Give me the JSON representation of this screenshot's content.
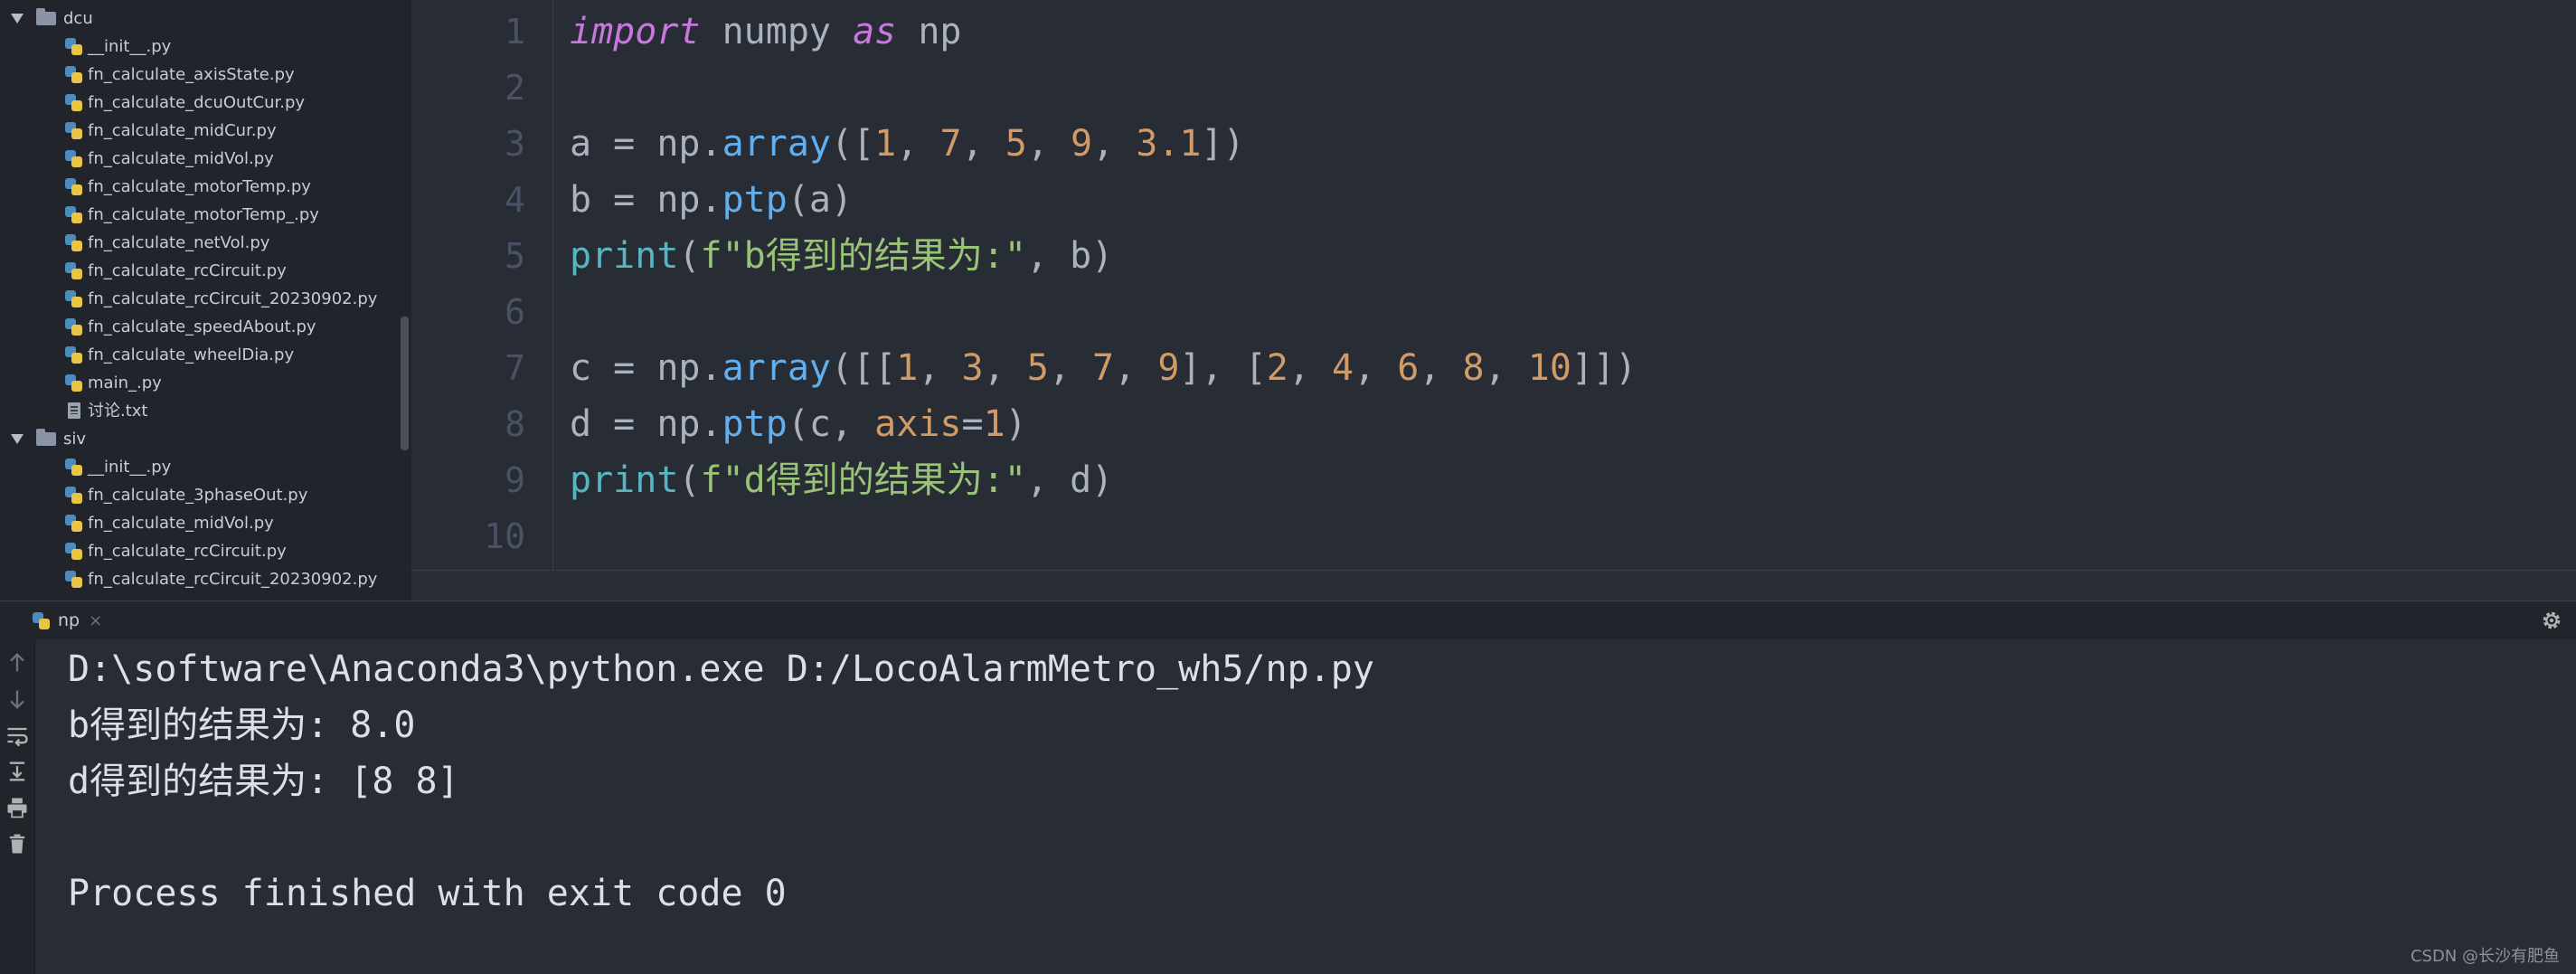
{
  "project_tree": {
    "folders": [
      {
        "name": "dcu",
        "files": [
          "__init__.py",
          "fn_calculate_axisState.py",
          "fn_calculate_dcuOutCur.py",
          "fn_calculate_midCur.py",
          "fn_calculate_midVol.py",
          "fn_calculate_motorTemp.py",
          "fn_calculate_motorTemp_.py",
          "fn_calculate_netVol.py",
          "fn_calculate_rcCircuit.py",
          "fn_calculate_rcCircuit_20230902.py",
          "fn_calculate_speedAbout.py",
          "fn_calculate_wheelDia.py",
          "main_.py",
          "讨论.txt"
        ]
      },
      {
        "name": "siv",
        "files": [
          "__init__.py",
          "fn_calculate_3phaseOut.py",
          "fn_calculate_midVol.py",
          "fn_calculate_rcCircuit.py",
          "fn_calculate_rcCircuit_20230902.py"
        ]
      }
    ]
  },
  "editor": {
    "line_numbers": [
      "1",
      "2",
      "3",
      "4",
      "5",
      "6",
      "7",
      "8",
      "9",
      "10"
    ],
    "code": {
      "l1": {
        "kw_import": "import",
        "t1": " numpy ",
        "kw_as": "as",
        "t2": " np"
      },
      "l3": {
        "t1": "a = np.",
        "fn": "array",
        "t2": "([",
        "n1": "1",
        "c1": ", ",
        "n2": "7",
        "c2": ", ",
        "n3": "5",
        "c3": ", ",
        "n4": "9",
        "c4": ", ",
        "n5": "3.1",
        "t3": "])"
      },
      "l4": {
        "t1": "b = np.",
        "fn": "ptp",
        "t2": "(a)"
      },
      "l5": {
        "bi": "print",
        "t1": "(",
        "str": "f\"b得到的结果为:\"",
        "t2": ", b)"
      },
      "l7": {
        "t1": "c = np.",
        "fn": "array",
        "t2": "([[",
        "n1": "1",
        "c1": ", ",
        "n2": "3",
        "c2": ", ",
        "n3": "5",
        "c3": ", ",
        "n4": "7",
        "c4": ", ",
        "n5": "9",
        "t3": "], [",
        "n6": "2",
        "c5": ", ",
        "n7": "4",
        "c6": ", ",
        "n8": "6",
        "c7": ", ",
        "n9": "8",
        "c8": ", ",
        "n10": "10",
        "t4": "]])"
      },
      "l8": {
        "t1": "d = np.",
        "fn": "ptp",
        "t2": "(c, ",
        "prm": "axis",
        "t3": "=",
        "n1": "1",
        "t4": ")"
      },
      "l9": {
        "bi": "print",
        "t1": "(",
        "str": "f\"d得到的结果为:\"",
        "t2": ", d)"
      }
    }
  },
  "run_panel": {
    "tab_label": "np",
    "tab_close": "×",
    "output": [
      "D:\\software\\Anaconda3\\python.exe D:/LocoAlarmMetro_wh5/np.py",
      "b得到的结果为: 8.0",
      "d得到的结果为: [8 8]",
      "",
      "Process finished with exit code 0"
    ]
  },
  "watermark": "CSDN @长沙有肥鱼",
  "icons": {
    "tree_expand": "triangle-down-icon",
    "folder": "folder-icon",
    "python_file": "python-file-icon",
    "text_file": "text-file-icon",
    "settings": "gear-icon",
    "side_tools": [
      "arrow-up-icon",
      "arrow-down-icon",
      "soft-wrap-icon",
      "scroll-to-end-icon",
      "print-icon",
      "trash-icon"
    ]
  },
  "colors": {
    "editor_bg": "#282c34",
    "panel_bg": "#21252b",
    "keyword": "#c678dd",
    "function": "#61afef",
    "builtin": "#56b6c2",
    "number": "#d19a66",
    "string": "#98c379"
  }
}
